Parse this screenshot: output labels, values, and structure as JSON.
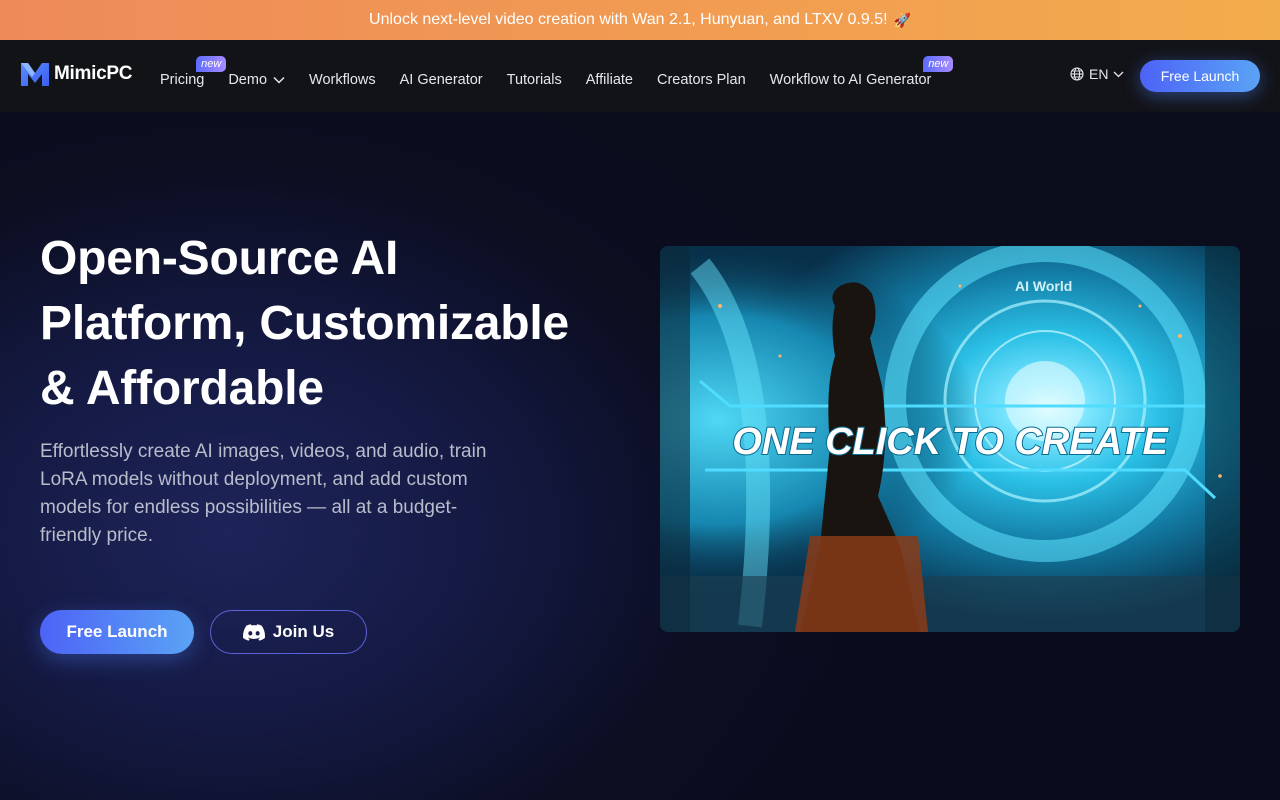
{
  "banner": {
    "text": "Unlock next-level video creation with Wan 2.1, Hunyuan, and LTXV 0.9.5!",
    "emoji": "🚀"
  },
  "nav": {
    "logo_text": "MimicPC",
    "items": [
      {
        "label": "Pricing",
        "badge": "new"
      },
      {
        "label": "Demo"
      },
      {
        "label": "Workflows"
      },
      {
        "label": "AI Generator"
      },
      {
        "label": "Tutorials"
      },
      {
        "label": "Affiliate"
      },
      {
        "label": "Creators Plan"
      },
      {
        "label": "Workflow to AI Generator",
        "badge": "new"
      }
    ],
    "language": "EN",
    "cta_label": "Free Launch"
  },
  "hero": {
    "title_lines": [
      "Open-Source AI",
      "Platform, Customizable",
      "& Affordable"
    ],
    "subtitle": "Effortlessly create AI images, videos, and audio, train LoRA models without deployment, and add custom models for endless possibilities — all at a budget-friendly price.",
    "primary_label": "Free Launch",
    "secondary_label": "Join Us",
    "video_caption": "ONE CLICK TO CREATE",
    "video_portal_text": "AI World"
  },
  "colors": {
    "banner_start": "#ee8a5a",
    "banner_end": "#f3ac4c",
    "accent_start": "#4d63f7",
    "accent_end": "#5aa3f5",
    "nav_bg": "#121317",
    "portal_cyan": "#2fc7e8"
  },
  "icons": {
    "logo": "mimicpc-logo-icon",
    "language": "globe-icon",
    "dropdown": "chevron-down-icon",
    "discord": "discord-icon",
    "banner": "rocket-icon"
  }
}
